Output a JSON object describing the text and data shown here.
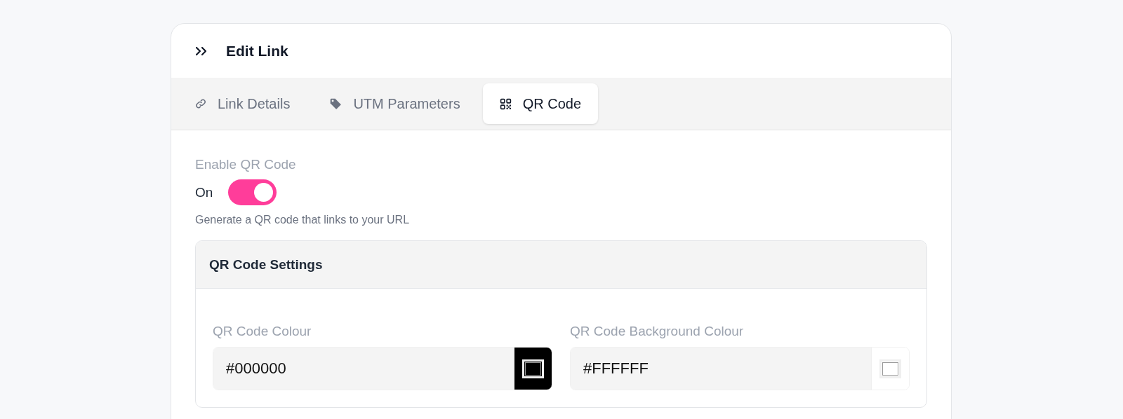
{
  "header": {
    "title": "Edit Link"
  },
  "tabs": [
    {
      "label": "Link Details",
      "kind": "link",
      "selected": false
    },
    {
      "label": "UTM Parameters",
      "kind": "tag",
      "selected": false
    },
    {
      "label": "QR Code",
      "kind": "qr",
      "selected": true
    }
  ],
  "enable": {
    "label": "Enable QR Code",
    "state_text": "On",
    "on": true,
    "help": "Generate a QR code that links to your URL"
  },
  "settings": {
    "title": "QR Code Settings",
    "fields": [
      {
        "label": "QR Code Colour",
        "value": "#000000"
      },
      {
        "label": "QR Code Background Colour",
        "value": "#FFFFFF"
      }
    ]
  }
}
